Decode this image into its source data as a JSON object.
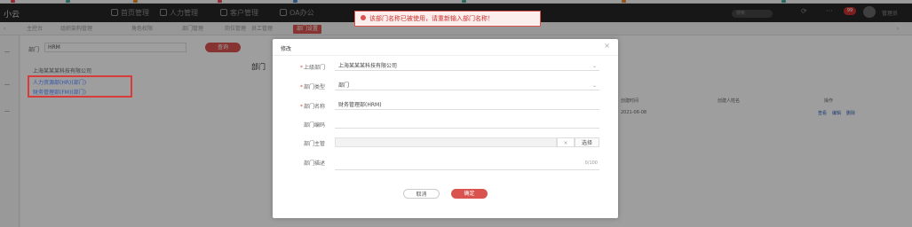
{
  "topbar": {
    "logo": "小云",
    "nav": [
      "首页管理",
      "人力管理",
      "客户管理",
      "OA办公"
    ],
    "search_placeholder": "搜索",
    "badge": "99",
    "user": "管理员"
  },
  "tabs": [
    "主控台",
    "组织架构管理",
    "角色权限",
    "部门管理",
    "岗位管理",
    "员工管理",
    "部门设置"
  ],
  "tree": {
    "root": "上海某某某科技有限公司",
    "items": [
      "人力资源部(HR)(部门)",
      "财务管理部(FM)(部门)"
    ]
  },
  "bg": {
    "search_label": "部门",
    "search_value": "HRM",
    "search_button": "查询",
    "panel_title": "部门",
    "col_headers": [
      "创建时间",
      "创建人姓名",
      "操作"
    ],
    "row_date": "2021-06-08",
    "row_actions": [
      "查看",
      "编辑",
      "删除"
    ]
  },
  "modal": {
    "title": "修改",
    "close": "×",
    "fields": {
      "superior_dept": {
        "label": "上级部门",
        "required": true,
        "value": "上海某某某科技有限公司"
      },
      "dept_type": {
        "label": "部门类型",
        "required": true,
        "value": "部门"
      },
      "dept_name": {
        "label": "部门名称",
        "required": true,
        "value": "财务管理部(HRM)"
      },
      "dept_code": {
        "label": "部门编码",
        "required": false,
        "value": ""
      },
      "dept_leader": {
        "label": "部门主管",
        "required": false,
        "value": "",
        "clear_icon": "×",
        "select_button": "选择"
      },
      "dept_desc": {
        "label": "部门描述",
        "required": false,
        "value": "",
        "counter": "0/100"
      }
    },
    "cancel_label": "取消",
    "ok_label": "确定"
  },
  "toast": {
    "message": "该部门名称已被使用，请重新输入部门名称！"
  },
  "colors": {
    "accent": "#d9534f",
    "topbar": "#262626"
  }
}
